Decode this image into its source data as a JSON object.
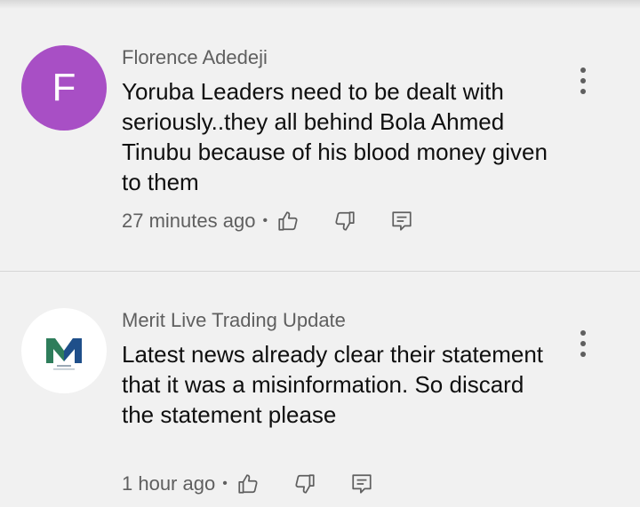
{
  "comments": [
    {
      "author": "Florence Adedeji",
      "avatar_letter": "F",
      "avatar_color": "#a84fc5",
      "text": "Yoruba Leaders need to be dealt with seriously..they all behind Bola Ahmed Tinubu because of his blood money given to them",
      "time": "27 minutes ago",
      "separator": "•",
      "icons": [
        "thumbs-up-icon",
        "thumbs-down-icon",
        "reply-icon",
        "more-vert-icon"
      ]
    },
    {
      "author": "Merit Live Trading Update",
      "avatar_letter": "M",
      "avatar_color": "#ffffff",
      "text": "Latest news already clear their statement that it was a misinformation. So discard the statement please",
      "time": "1 hour ago",
      "separator": "•",
      "icons": [
        "thumbs-up-icon",
        "thumbs-down-icon",
        "reply-icon",
        "more-vert-icon"
      ]
    }
  ],
  "colors": {
    "background": "#f1f1f1",
    "text": "#0f0f0f",
    "secondary_text": "#5f5f5f",
    "divider": "#d6d6d6"
  }
}
